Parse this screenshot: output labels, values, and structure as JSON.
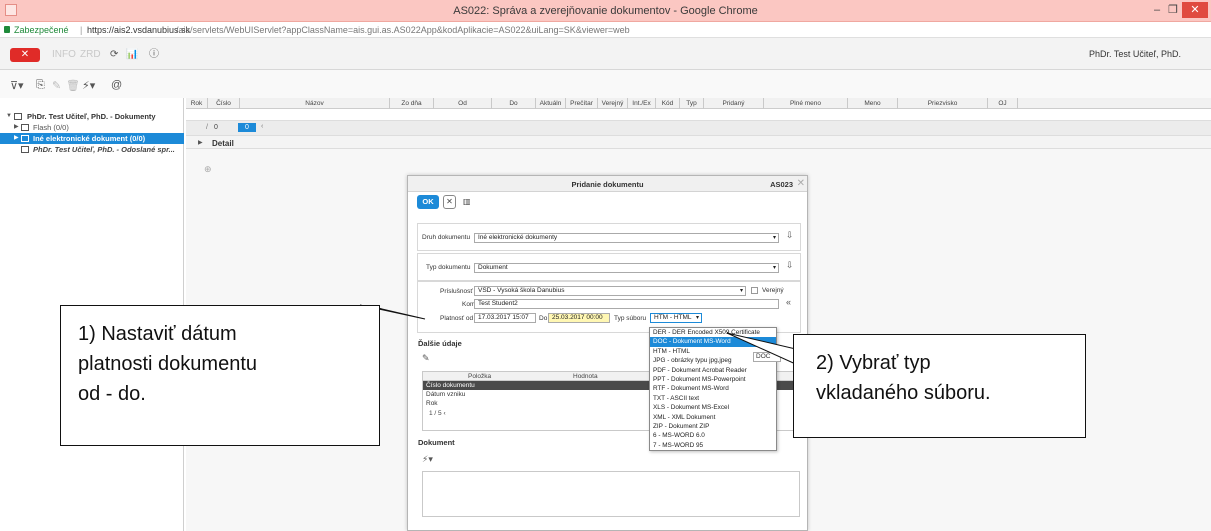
{
  "browser": {
    "window_title": "AS022: Správa a zverejňovanie dokumentov - Google Chrome",
    "minimize_glyph": "–",
    "maximize_glyph": "❐",
    "close_glyph": "✕",
    "secure_label": "Zabezpečené",
    "url_host": "https://ais2.vsdanubius.sk",
    "url_path": "/ais/servlets/WebUIServlet?appClassName=ais.gui.as.AS022App&kodAplikacie=AS022&uiLang=SK&viewer=web"
  },
  "app_toolbar": {
    "close_label": "✕",
    "item_1": "INFO",
    "item_2": "ZRD",
    "refresh_icon": "⟳",
    "stats_icon": "📊",
    "info_icon": "ⓘ",
    "user_name": "PhDr. Test Učiteľ, PhD."
  },
  "toolbar2": {
    "filter_icon": "⊽▾",
    "new_icon": "⎘",
    "edit_icon": "✎",
    "delete_icon": "🗑",
    "run_icon": "⚡▾",
    "email_icon": "@"
  },
  "tree": {
    "root": "PhDr. Test Učiteľ, PhD. - Dokumenty",
    "flash": "Flash (0/0)",
    "ine": "Iné elektronické dokument (0/0)",
    "sent": "PhDr. Test Učiteľ, PhD. - Odoslané spr..."
  },
  "table": {
    "columns": [
      "Rok",
      "Číslo",
      "Názov",
      "Zo dňa",
      "Od",
      "Do",
      "Aktuáln",
      "Prečítar",
      "Verejný",
      "Int./Ex",
      "Kód",
      "Typ",
      "Pridaný",
      "Plné meno",
      "Meno",
      "Priezvisko",
      "OJ"
    ],
    "pager_sep": "/",
    "pager_current": "0",
    "pager_total": "0",
    "pager_arrow": "‹"
  },
  "detail": {
    "label": "Detail"
  },
  "dialog": {
    "title": "Pridanie dokumentu",
    "code": "AS023",
    "ok_label": "OK",
    "cancel_label": "✕",
    "druh_label": "Druh dokumentu",
    "druh_value": "Iné elektronické dokumenty",
    "typ_label": "Typ dokumentu",
    "typ_value": "Dokument",
    "prislusnost_label": "Príslušnosť",
    "prislusnost_value": "VŠD - Vysoká škola Danubius",
    "verejny_label": "Verejný",
    "komu_label": "Komu",
    "komu_value": "Test Študent2",
    "platnost_od_label": "Platnosť od",
    "platnost_od_value": "17.03.2017 15:07",
    "do_label": "Do",
    "do_value": "25.03.2017 00:00",
    "typ_suboru_label": "Typ súboru",
    "typ_suboru_value": "HTM - HTML",
    "dalsie_udaje": "Ďalšie údaje",
    "col_polozka": "Položka",
    "col_hodnota": "Hodnota",
    "rows": [
      "Číslo dokumentu",
      "Dátum vzniku",
      "Rok"
    ],
    "item_pager": "1   /   5   ‹",
    "dokument_section": "Dokument",
    "file_types": [
      "DER - DER Encoded X509 Certificate",
      "DOC - Dokument MS-Word",
      "HTM - HTML",
      "JPG - obrázky typu jpg,jpeg",
      "PDF - Dokument Acrobat Reader",
      "PPT - Dokument MS-Powerpoint",
      "RTF - Dokument MS-Word",
      "TXT - ASCII text",
      "XLS - Dokument MS-Excel",
      "XML - XML Dokument",
      "ZIP - Dokument ZIP",
      "6 - MS-WORD 6.0",
      "7 - MS-WORD 95"
    ],
    "tooltip": "DOC"
  },
  "callouts": {
    "c1_line1": "1) Nastaviť dátum",
    "c1_line2": "platnosti dokumentu",
    "c1_line3": "od - do.",
    "c2_line1": "2) Vybrať typ",
    "c2_line2": "vkladaného súboru."
  }
}
